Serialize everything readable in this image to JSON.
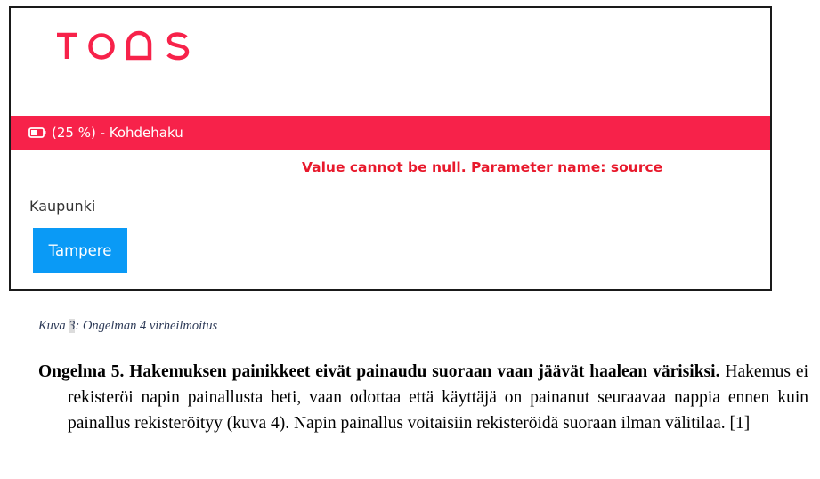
{
  "app": {
    "logo_text": "TOAS",
    "brand_color": "#f7224a"
  },
  "progress": {
    "icon": "battery-icon",
    "percent_value": 25,
    "text": "(25 %) - Kohdehaku"
  },
  "error": {
    "message": "Value cannot be null. Parameter name: source",
    "color": "#e8192c"
  },
  "field": {
    "label": "Kaupunki"
  },
  "city_button": {
    "label": "Tampere",
    "color": "#0a9af6"
  },
  "caption": {
    "prefix": "Kuva ",
    "number": "3",
    "suffix": ": Ongelman 4 virheilmoitus"
  },
  "problem": {
    "title": "Ongelma 5. Hakemuksen painikkeet eivät painaudu suoraan vaan jäävät haalean värisiksi.",
    "body": " Hakemus ei rekisteröi napin painallusta heti, vaan odottaa että käyttäjä on painanut seuraavaa nappia ennen kuin painallus rekisteröityy (kuva 4). Napin painallus voitaisiin rekisteröidä suoraan ilman välitilaa. [1]"
  }
}
